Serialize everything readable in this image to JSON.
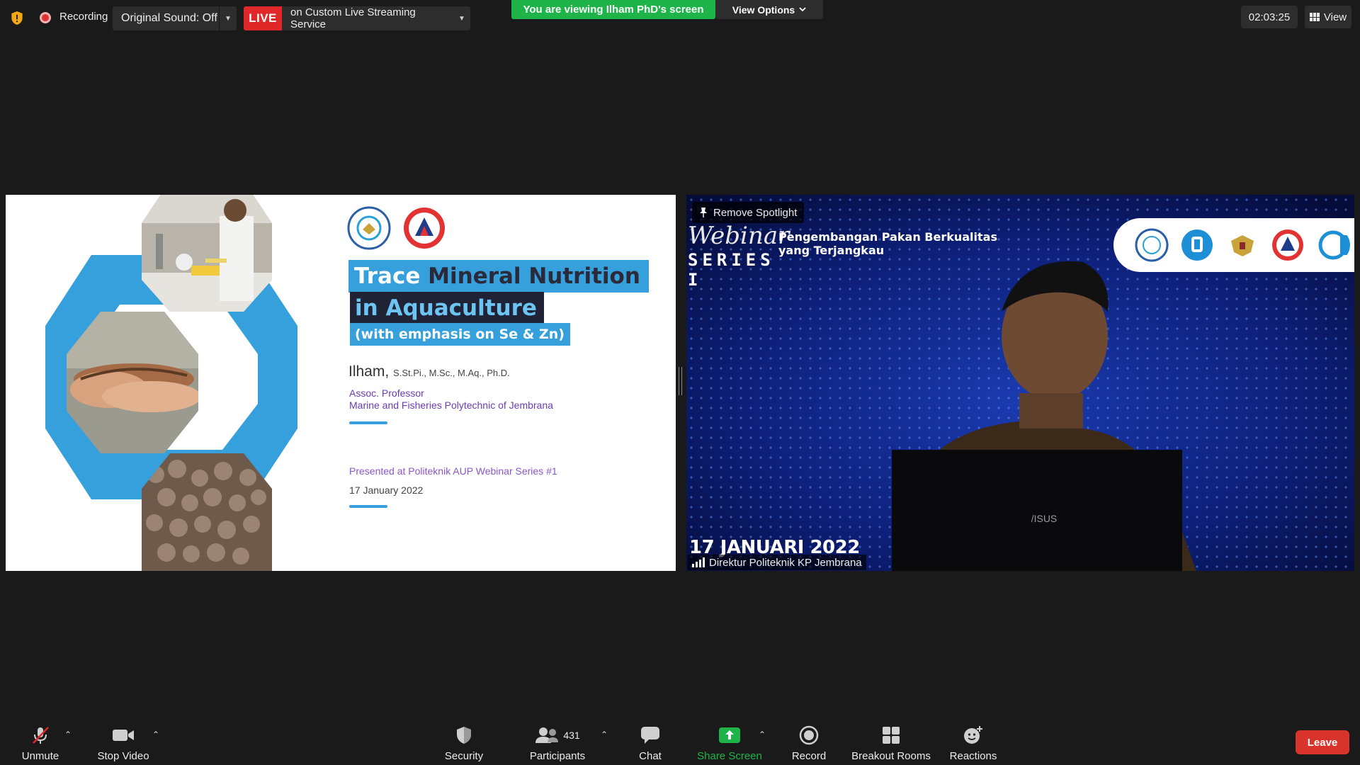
{
  "top_bar": {
    "recording_label": "Recording",
    "original_sound": "Original Sound: Off",
    "live_badge": "LIVE",
    "live_service": "on Custom Live Streaming Service",
    "viewing_banner": "You are viewing Ilham PhD's screen",
    "view_options": "View Options",
    "timer": "02:03:25",
    "view_button": "View"
  },
  "slide": {
    "title_line1_a": "Trace",
    "title_line1_b": "Mineral Nutrition",
    "title_line2": "in Aquaculture",
    "title_line3": "(with emphasis on Se & Zn)",
    "author_name": "Ilham,",
    "author_degrees": "S.St.Pi., M.Sc., M.Aq., Ph.D.",
    "role_title": "Assoc. Professor",
    "role_institution": "Marine and Fisheries Polytechnic of Jembrana",
    "presented_at": "Presented at Politeknik AUP Webinar Series #1",
    "date": "17 January 2022"
  },
  "video": {
    "remove_spotlight": "Remove Spotlight",
    "webinar_script": "Webinar",
    "series_text": "SERIES I",
    "subtitle_line1": "Pengembangan Pakan Berkualitas",
    "subtitle_line2": "yang Terjangkau",
    "video_date": "17 JANUARI 2022",
    "participant_name": "Direktur Politeknik KP Jembrana",
    "laptop_brand": "/ISUS"
  },
  "toolbar": {
    "unmute": "Unmute",
    "stop_video": "Stop Video",
    "security": "Security",
    "participants": "Participants",
    "participants_count": "431",
    "chat": "Chat",
    "share_screen": "Share Screen",
    "record": "Record",
    "breakout_rooms": "Breakout Rooms",
    "reactions": "Reactions",
    "leave": "Leave"
  },
  "colors": {
    "background": "#1a1a1a",
    "live_red": "#e02828",
    "banner_green": "#1eb449",
    "slide_blue": "#35a0dc",
    "leave_red": "#d9342b"
  }
}
